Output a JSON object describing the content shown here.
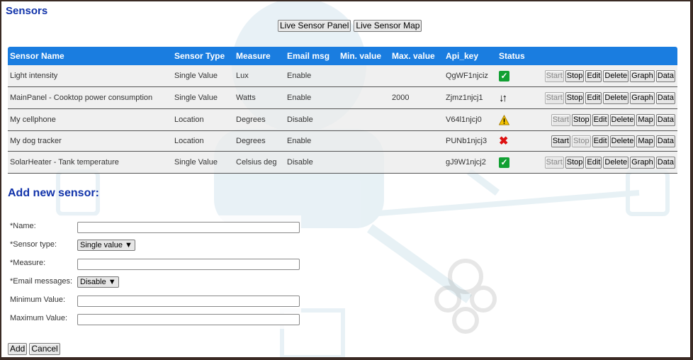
{
  "page": {
    "title": "Sensors"
  },
  "top_buttons": {
    "live_panel": "Live Sensor Panel",
    "live_map": "Live Sensor Map"
  },
  "table": {
    "headers": [
      "Sensor Name",
      "Sensor Type",
      "Measure",
      "Email msg",
      "Min. value",
      "Max. value",
      "Api_key",
      "Status",
      ""
    ],
    "rows": [
      {
        "name": "Light intensity",
        "type": "Single Value",
        "measure": "Lux",
        "email": "Enable",
        "min": "",
        "max": "",
        "api_key": "QgWF1njciz",
        "status": "ok",
        "chart_btn": "Graph"
      },
      {
        "name": "MainPanel - Cooktop power consumption",
        "type": "Single Value",
        "measure": "Watts",
        "email": "Enable",
        "min": "",
        "max": "2000",
        "api_key": "Zjmz1njcj1",
        "status": "transfer",
        "chart_btn": "Graph"
      },
      {
        "name": "My cellphone",
        "type": "Location",
        "measure": "Degrees",
        "email": "Disable",
        "min": "",
        "max": "",
        "api_key": "V64l1njcj0",
        "status": "warning",
        "chart_btn": "Map"
      },
      {
        "name": "My dog tracker",
        "type": "Location",
        "measure": "Degrees",
        "email": "Enable",
        "min": "",
        "max": "",
        "api_key": "PUNb1njcj3",
        "status": "error",
        "chart_btn": "Map"
      },
      {
        "name": "SolarHeater - Tank temperature",
        "type": "Single Value",
        "measure": "Celsius deg",
        "email": "Disable",
        "min": "",
        "max": "",
        "api_key": "gJ9W1njcj2",
        "status": "ok",
        "chart_btn": "Graph"
      }
    ],
    "action_labels": {
      "start": "Start",
      "stop": "Stop",
      "edit": "Edit",
      "delete": "Delete",
      "data": "Data"
    }
  },
  "status_icons": {
    "ok": "check-icon",
    "transfer": "transfer-arrows-icon",
    "warning": "warning-icon",
    "error": "error-x-icon"
  },
  "add_form": {
    "title": "Add new sensor:",
    "name_label": "*Name:",
    "type_label": "*Sensor type:",
    "type_value": "Single value",
    "measure_label": "*Measure:",
    "email_label": "*Email messages:",
    "email_value": "Disable",
    "min_label": "Minimum Value:",
    "max_label": "Maximum Value:",
    "add_button": "Add",
    "cancel_button": "Cancel"
  },
  "colors": {
    "header_blue": "#1a7de0",
    "title_blue": "#1133aa",
    "ok_green": "#12a033",
    "error_red": "#dd1111",
    "warning_yellow": "#f5c400"
  }
}
